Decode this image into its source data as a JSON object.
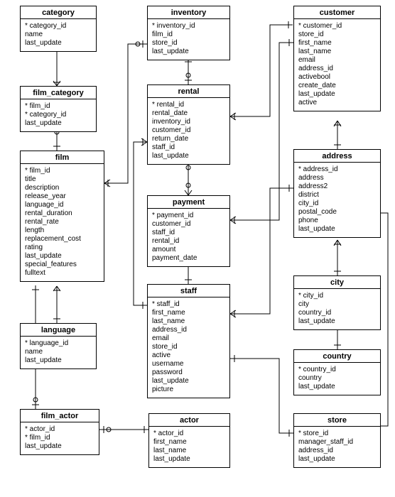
{
  "entities": {
    "category": {
      "name": "category",
      "fields": [
        "* category_id",
        "  name",
        "  last_update"
      ]
    },
    "film_category": {
      "name": "film_category",
      "fields": [
        "* film_id",
        "* category_id",
        "  last_update"
      ]
    },
    "film": {
      "name": "film",
      "fields": [
        "* film_id",
        "  title",
        "  description",
        "  release_year",
        "  language_id",
        "  rental_duration",
        "  rental_rate",
        "  length",
        "  replacement_cost",
        "  rating",
        "  last_update",
        "  special_features",
        "  fulltext"
      ]
    },
    "language": {
      "name": "language",
      "fields": [
        "* language_id",
        "  name",
        "  last_update"
      ]
    },
    "film_actor": {
      "name": "film_actor",
      "fields": [
        "* actor_id",
        "* film_id",
        "  last_update"
      ]
    },
    "inventory": {
      "name": "inventory",
      "fields": [
        "* inventory_id",
        "  film_id",
        "  store_id",
        "  last_update"
      ]
    },
    "rental": {
      "name": "rental",
      "fields": [
        "* rental_id",
        "  rental_date",
        "  inventory_id",
        "  customer_id",
        "  return_date",
        "  staff_id",
        "  last_update"
      ]
    },
    "payment": {
      "name": "payment",
      "fields": [
        "* payment_id",
        "  customer_id",
        "  staff_id",
        "  rental_id",
        "  amount",
        "  payment_date"
      ]
    },
    "staff": {
      "name": "staff",
      "fields": [
        "* staff_id",
        "  first_name",
        "  last_name",
        "  address_id",
        "  email",
        "  store_id",
        "  active",
        "  username",
        "  password",
        "  last_update",
        "  picture"
      ]
    },
    "actor": {
      "name": "actor",
      "fields": [
        "* actor_id",
        "  first_name",
        "  last_name",
        "  last_update"
      ]
    },
    "customer": {
      "name": "customer",
      "fields": [
        "* customer_id",
        "  store_id",
        "  first_name",
        "  last_name",
        "  email",
        "  address_id",
        "  activebool",
        "  create_date",
        "  last_update",
        "  active"
      ]
    },
    "address": {
      "name": "address",
      "fields": [
        "* address_id",
        "  address",
        "  address2",
        "  district",
        "  city_id",
        "  postal_code",
        "  phone",
        "  last_update"
      ]
    },
    "city": {
      "name": "city",
      "fields": [
        "* city_id",
        "  city",
        "  country_id",
        "  last_update"
      ]
    },
    "country": {
      "name": "country",
      "fields": [
        "* country_id",
        "  country",
        "  last_update"
      ]
    },
    "store": {
      "name": "store",
      "fields": [
        "* store_id",
        "  manager_staff_id",
        "  address_id",
        "  last_update"
      ]
    }
  },
  "relationships": [
    {
      "from": "film_category",
      "to": "category",
      "fk": "category_id"
    },
    {
      "from": "film_category",
      "to": "film",
      "fk": "film_id"
    },
    {
      "from": "film",
      "to": "language",
      "fk": "language_id"
    },
    {
      "from": "film_actor",
      "to": "film",
      "fk": "film_id"
    },
    {
      "from": "film_actor",
      "to": "actor",
      "fk": "actor_id"
    },
    {
      "from": "inventory",
      "to": "film",
      "fk": "film_id"
    },
    {
      "from": "rental",
      "to": "inventory",
      "fk": "inventory_id"
    },
    {
      "from": "rental",
      "to": "customer",
      "fk": "customer_id"
    },
    {
      "from": "rental",
      "to": "staff",
      "fk": "staff_id"
    },
    {
      "from": "payment",
      "to": "rental",
      "fk": "rental_id"
    },
    {
      "from": "payment",
      "to": "customer",
      "fk": "customer_id"
    },
    {
      "from": "payment",
      "to": "staff",
      "fk": "staff_id"
    },
    {
      "from": "staff",
      "to": "address",
      "fk": "address_id"
    },
    {
      "from": "staff",
      "to": "store",
      "fk": "store_id"
    },
    {
      "from": "customer",
      "to": "address",
      "fk": "address_id"
    },
    {
      "from": "address",
      "to": "city",
      "fk": "city_id"
    },
    {
      "from": "city",
      "to": "country",
      "fk": "country_id"
    },
    {
      "from": "store",
      "to": "address",
      "fk": "address_id"
    },
    {
      "from": "store",
      "to": "staff",
      "fk": "manager_staff_id"
    }
  ]
}
